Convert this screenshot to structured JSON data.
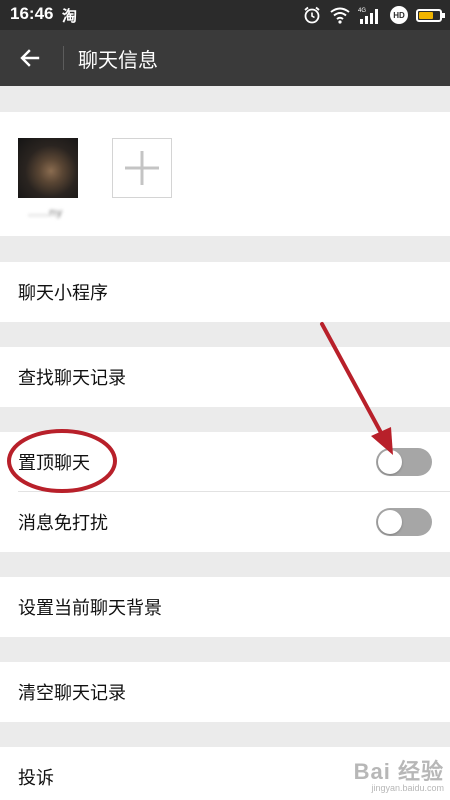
{
  "status_bar": {
    "time": "16:46",
    "app_icon": "淘",
    "network": "4G",
    "badge": "HD",
    "battery_level": 0.7,
    "icons": [
      "alarm-icon",
      "wifi-icon",
      "signal-icon",
      "hd-icon",
      "battery-icon"
    ]
  },
  "app_bar": {
    "back_icon": "back-arrow-icon",
    "title": "聊天信息"
  },
  "members": {
    "avatar_icon": "avatar",
    "name": "......ny",
    "add_icon": "plus-icon"
  },
  "rows": {
    "mini_programs": "聊天小程序",
    "search_history": "查找聊天记录",
    "pin_chat": "置顶聊天",
    "pin_chat_on": false,
    "mute": "消息免打扰",
    "mute_on": false,
    "set_background": "设置当前聊天背景",
    "clear_history": "清空聊天记录",
    "report": "投诉"
  },
  "annotation": {
    "circle_color": "#b8202a",
    "arrow_color": "#b8202a"
  },
  "watermark": {
    "brand": "Bai 经验",
    "url": "jingyan.baidu.com"
  },
  "colors": {
    "app_bar": "#3a3a3a",
    "status_bar": "#2b2b2b",
    "page_bg": "#ebebeb",
    "toggle_off": "#a6a6a6",
    "battery": "#f0b400"
  }
}
